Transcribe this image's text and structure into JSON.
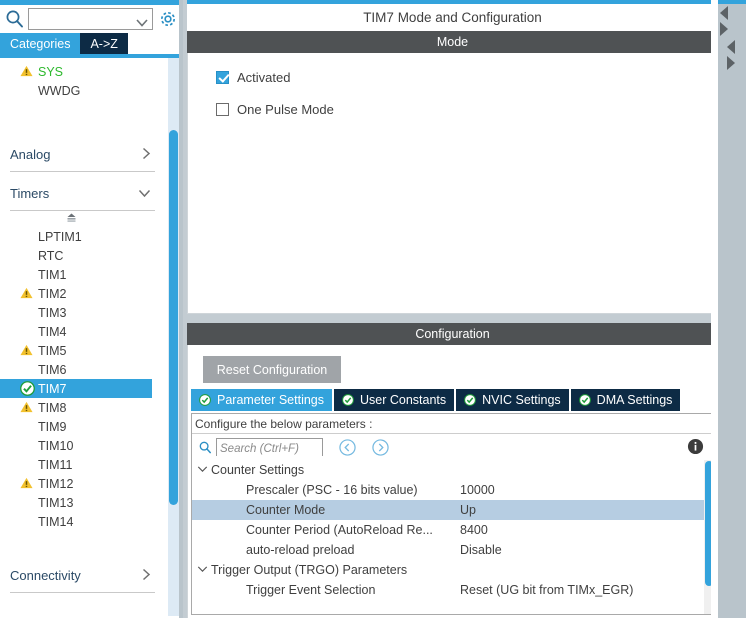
{
  "left_panel": {
    "search": {
      "value": "",
      "placeholder": ""
    },
    "gear_tooltip": "",
    "tabs": [
      {
        "label": "Categories",
        "selected": true
      },
      {
        "label": "A->Z",
        "selected": false
      }
    ],
    "top_items": [
      {
        "label": "SYS",
        "warn": true,
        "green": true
      },
      {
        "label": "WWDG",
        "warn": false,
        "green": false
      }
    ],
    "groups": [
      {
        "label": "Analog",
        "expanded": false
      },
      {
        "label": "Timers",
        "expanded": true
      }
    ],
    "timers": [
      {
        "label": "LPTIM1",
        "warn": false,
        "selected": false
      },
      {
        "label": "RTC",
        "warn": false,
        "selected": false
      },
      {
        "label": "TIM1",
        "warn": false,
        "selected": false
      },
      {
        "label": "TIM2",
        "warn": true,
        "selected": false
      },
      {
        "label": "TIM3",
        "warn": false,
        "selected": false
      },
      {
        "label": "TIM4",
        "warn": false,
        "selected": false
      },
      {
        "label": "TIM5",
        "warn": true,
        "selected": false
      },
      {
        "label": "TIM6",
        "warn": false,
        "selected": false
      },
      {
        "label": "TIM7",
        "warn": false,
        "selected": true
      },
      {
        "label": "TIM8",
        "warn": true,
        "selected": false
      },
      {
        "label": "TIM9",
        "warn": false,
        "selected": false
      },
      {
        "label": "TIM10",
        "warn": false,
        "selected": false
      },
      {
        "label": "TIM11",
        "warn": false,
        "selected": false
      },
      {
        "label": "TIM12",
        "warn": true,
        "selected": false
      },
      {
        "label": "TIM13",
        "warn": false,
        "selected": false
      },
      {
        "label": "TIM14",
        "warn": false,
        "selected": false
      }
    ],
    "bottom_group": {
      "label": "Connectivity",
      "expanded": false
    }
  },
  "main": {
    "header_title": "TIM7 Mode and Configuration",
    "mode_section": {
      "bar_label": "Mode",
      "checkboxes": [
        {
          "label": "Activated",
          "checked": true
        },
        {
          "label": "One Pulse Mode",
          "checked": false
        }
      ]
    },
    "config_section": {
      "bar_label": "Configuration",
      "reset_label": "Reset Configuration",
      "tabs": [
        {
          "label": "Parameter Settings",
          "selected": true
        },
        {
          "label": "User Constants",
          "selected": false
        },
        {
          "label": "NVIC Settings",
          "selected": false
        },
        {
          "label": "DMA Settings",
          "selected": false
        }
      ],
      "configure_label": "Configure the below parameters :",
      "search": {
        "value": "",
        "placeholder": "Search (Ctrl+F)"
      },
      "rows": [
        {
          "kind": "group",
          "name": "Counter Settings",
          "value": "",
          "expanded": true,
          "selected": false
        },
        {
          "kind": "param",
          "name": "Prescaler (PSC - 16 bits value)",
          "value": "10000",
          "selected": false
        },
        {
          "kind": "param",
          "name": "Counter Mode",
          "value": "Up",
          "selected": true
        },
        {
          "kind": "param",
          "name": "Counter Period (AutoReload Re...",
          "value": "8400",
          "selected": false
        },
        {
          "kind": "param",
          "name": "auto-reload preload",
          "value": "Disable",
          "selected": false
        },
        {
          "kind": "group",
          "name": "Trigger Output (TRGO) Parameters",
          "value": "",
          "expanded": true,
          "selected": false
        },
        {
          "kind": "param",
          "name": "Trigger Event Selection",
          "value": "Reset (UG bit from TIMx_EGR)",
          "selected": false
        }
      ]
    }
  },
  "colors": {
    "accent_blue": "#33a3dc",
    "dark_navy": "#0d2b45",
    "section_bar": "#4f5254",
    "warn_yellow": "#f2c12e",
    "ok_green": "#2eb82e",
    "row_select": "#b6cde2",
    "panel_bg": "#c3ccd2"
  }
}
